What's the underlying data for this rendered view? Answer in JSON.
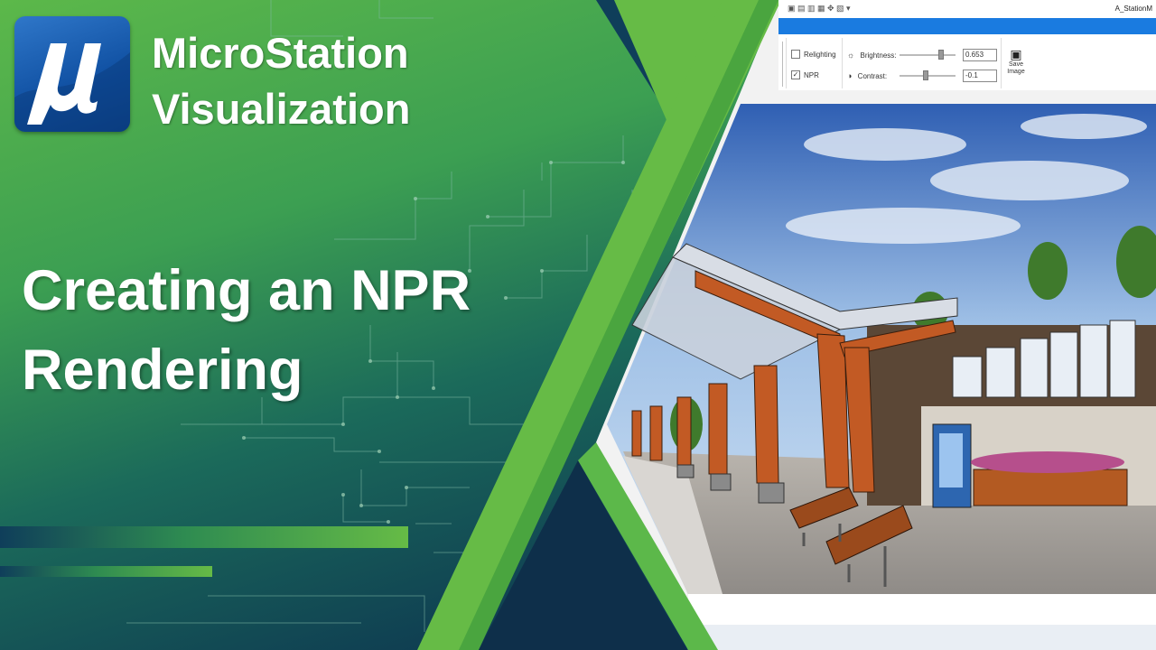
{
  "brand": {
    "line1": "MicroStation",
    "line2": "Visualization",
    "logo_glyph": "μ"
  },
  "headline": {
    "line1": "Creating an NPR",
    "line2": "Rendering"
  },
  "window": {
    "title": "A_StationM"
  },
  "ribbon": {
    "relighting_label": "Relighting",
    "npr_label": "NPR",
    "npr_checked": true,
    "brightness_label": "Brightness:",
    "brightness_value": "0.653",
    "contrast_label": "Contrast:",
    "contrast_value": "-0.1",
    "save_image_line1": "Save",
    "save_image_line2": "Image"
  },
  "colors": {
    "green": "#66bb46",
    "dark_teal": "#0e3b4e",
    "logo_blue": "#1a5cb0",
    "window_blue": "#1a7be0"
  },
  "icons": [
    "mu-logo-icon",
    "save-image-icon",
    "brightness-icon",
    "contrast-icon"
  ]
}
